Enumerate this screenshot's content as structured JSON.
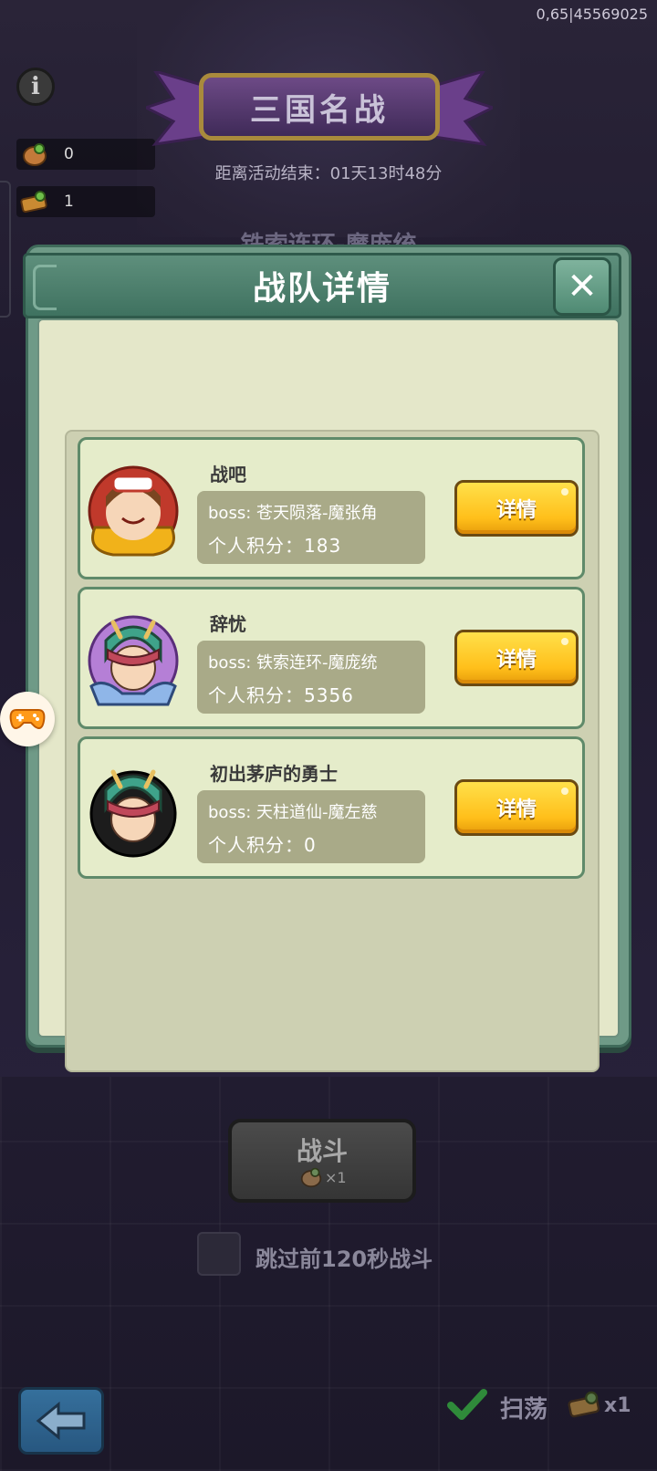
{
  "top_right_id": "0,65|45569025",
  "resources": [
    {
      "icon": "coin-bag-icon",
      "value": "0"
    },
    {
      "icon": "ticket-icon",
      "value": "1"
    }
  ],
  "event": {
    "title": "三国名战",
    "countdown": "距离活动结束：01天13时48分",
    "faded_subtitle": "铁索连环-魔庞统"
  },
  "modal": {
    "title": "战队详情",
    "teams": [
      {
        "name": "战吧",
        "boss": "boss: 苍天陨落-魔张角",
        "score": "个人积分：183",
        "button": "详情",
        "avatar": "lion-hat-girl-avatar"
      },
      {
        "name": "辞忧",
        "boss": "boss: 铁索连环-魔庞统",
        "score": "个人积分：5356",
        "button": "详情",
        "avatar": "dragon-helmet-avatar"
      },
      {
        "name": "初出茅庐的勇士",
        "boss": "boss: 天柱道仙-魔左慈",
        "score": "个人积分：0",
        "button": "详情",
        "avatar": "dragon-helmet-avatar-dark"
      }
    ]
  },
  "fight": {
    "label": "战斗",
    "cost": "×1"
  },
  "skip": {
    "label": "跳过前120秒战斗"
  },
  "sweep": {
    "label": "扫荡",
    "count": "x1"
  },
  "colors": {
    "accent_yellow": "#ffc61e",
    "panel_green": "#6f9a87",
    "card_bg": "#e5ecca"
  }
}
